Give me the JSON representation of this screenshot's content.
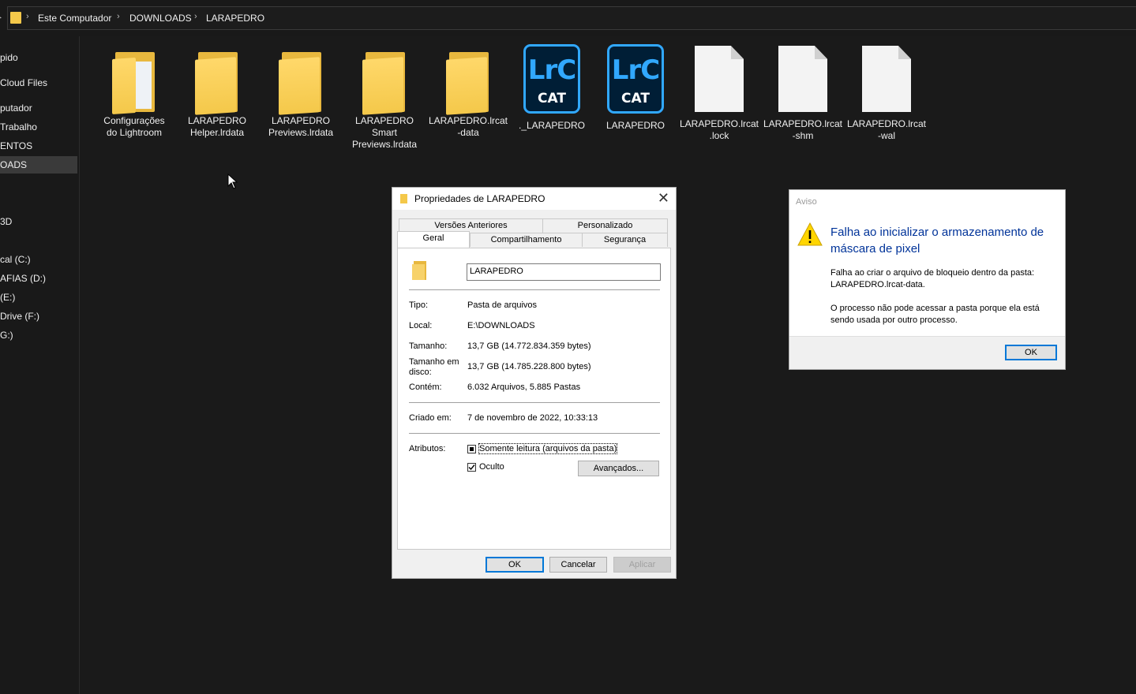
{
  "addressbar": {
    "crumbs": [
      "Este Computador",
      "DOWNLOADS",
      "LARAPEDRO"
    ]
  },
  "nav": {
    "items": [
      {
        "label": "pido"
      },
      {
        "label": "Cloud Files"
      },
      {
        "label": "putador"
      },
      {
        "label": "Trabalho"
      },
      {
        "label": "ENTOS"
      },
      {
        "label": "OADS"
      },
      {
        "label": "3D"
      },
      {
        "label": "cal (C:)"
      },
      {
        "label": "AFIAS (D:)"
      },
      {
        "label": "(E:)"
      },
      {
        "label": "Drive (F:)"
      },
      {
        "label": "G:)"
      }
    ]
  },
  "files": [
    {
      "line1": "Configurações",
      "line2": "do Lightroom",
      "line3": "",
      "icon": "folder-icon"
    },
    {
      "line1": "LARAPEDRO",
      "line2": "Helper.lrdata",
      "line3": "",
      "icon": "folder-icon"
    },
    {
      "line1": "LARAPEDRO",
      "line2": "Previews.lrdata",
      "line3": "",
      "icon": "folder-icon"
    },
    {
      "line1": "LARAPEDRO",
      "line2": "Smart",
      "line3": "Previews.lrdata",
      "icon": "folder-icon"
    },
    {
      "line1": "LARAPEDRO.lrcat",
      "line2": "-data",
      "line3": "",
      "icon": "folder-icon"
    },
    {
      "line1": "._LARAPEDRO",
      "line2": "",
      "line3": "",
      "icon": "lrc-catalog-icon",
      "icon_text1": "LrC",
      "icon_text2": "CAT"
    },
    {
      "line1": "LARAPEDRO",
      "line2": "",
      "line3": "",
      "icon": "lrc-catalog-icon",
      "icon_text1": "LrC",
      "icon_text2": "CAT"
    },
    {
      "line1": "LARAPEDRO.lrcat",
      "line2": ".lock",
      "line3": "",
      "icon": "file-icon"
    },
    {
      "line1": "LARAPEDRO.lrcat",
      "line2": "-shm",
      "line3": "",
      "icon": "file-icon"
    },
    {
      "line1": "LARAPEDRO.lrcat",
      "line2": "-wal",
      "line3": "",
      "icon": "file-icon"
    }
  ],
  "properties": {
    "title": "Propriedades de LARAPEDRO",
    "tabs_row1": [
      "Versões Anteriores",
      "Personalizado"
    ],
    "tabs_row2": [
      "Geral",
      "Compartilhamento",
      "Segurança"
    ],
    "name_value": "LARAPEDRO",
    "rows": {
      "tipo": {
        "label": "Tipo:",
        "value": "Pasta de arquivos"
      },
      "local": {
        "label": "Local:",
        "value": "E:\\DOWNLOADS"
      },
      "tamanho": {
        "label": "Tamanho:",
        "value": "13,7 GB (14.772.834.359 bytes)"
      },
      "tamanho_disco": {
        "label1": "Tamanho em",
        "label2": "disco:",
        "value": "13,7 GB (14.785.228.800 bytes)"
      },
      "contem": {
        "label": "Contém:",
        "value": "6.032 Arquivos, 5.885 Pastas"
      },
      "criado": {
        "label": "Criado em:",
        "value": "7 de novembro de 2022, 10:33:13"
      },
      "atributos": {
        "label": "Atributos:"
      }
    },
    "readonly_label": "Somente leitura (arquivos da pasta)",
    "readonly_state": "indeterminate",
    "hidden_label": "Oculto",
    "hidden_checked": true,
    "advanced_button": "Avançados...",
    "ok_button": "OK",
    "cancel_button": "Cancelar",
    "apply_button": "Aplicar"
  },
  "warning": {
    "title": "Aviso",
    "heading": "Falha ao inicializar o armazenamento de máscara de pixel",
    "body1": "Falha ao criar o arquivo de bloqueio dentro da pasta: LARAPEDRO.lrcat-data.",
    "body2": "O processo não pode acessar a pasta porque ela está sendo usada por outro processo.",
    "ok_button": "OK"
  },
  "colors": {
    "explorer_bg": "#191919",
    "folder_yellow": "#f4c84a",
    "lrc_blue": "#31a8ff",
    "lrc_navy": "#001e36",
    "dialog_accent": "#0078d7",
    "warning_heading": "#003399"
  }
}
